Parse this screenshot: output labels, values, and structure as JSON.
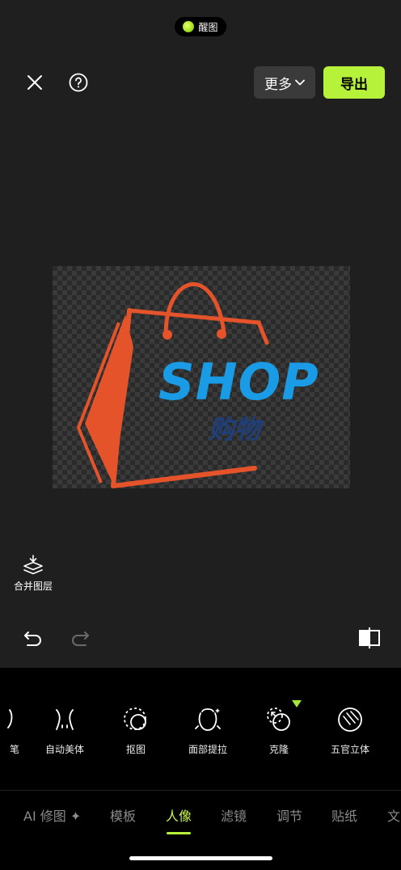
{
  "status": {
    "pill_label": "醒图"
  },
  "topbar": {
    "more_label": "更多",
    "export_label": "导出"
  },
  "canvas": {
    "logo_text": "SHOP",
    "logo_cn_text": "购物"
  },
  "merge_layers": {
    "label": "合并图层"
  },
  "tools": [
    {
      "label": "笔",
      "icon": "brush-icon"
    },
    {
      "label": "自动美体",
      "icon": "body-shape-icon"
    },
    {
      "label": "抠图",
      "icon": "cutout-icon"
    },
    {
      "label": "面部提拉",
      "icon": "face-lift-icon"
    },
    {
      "label": "克隆",
      "icon": "clone-icon"
    },
    {
      "label": "五官立体",
      "icon": "facial-contour-icon"
    }
  ],
  "tabs": [
    {
      "label": "AI 修图 ✦"
    },
    {
      "label": "模板"
    },
    {
      "label": "人像"
    },
    {
      "label": "滤镜"
    },
    {
      "label": "调节"
    },
    {
      "label": "贴纸"
    },
    {
      "label": "文"
    }
  ],
  "colors": {
    "accent": "#b6f23a",
    "background": "#1f1f1f",
    "panel": "#000000",
    "logo_orange": "#e5532a",
    "logo_blue": "#1a9be6"
  }
}
